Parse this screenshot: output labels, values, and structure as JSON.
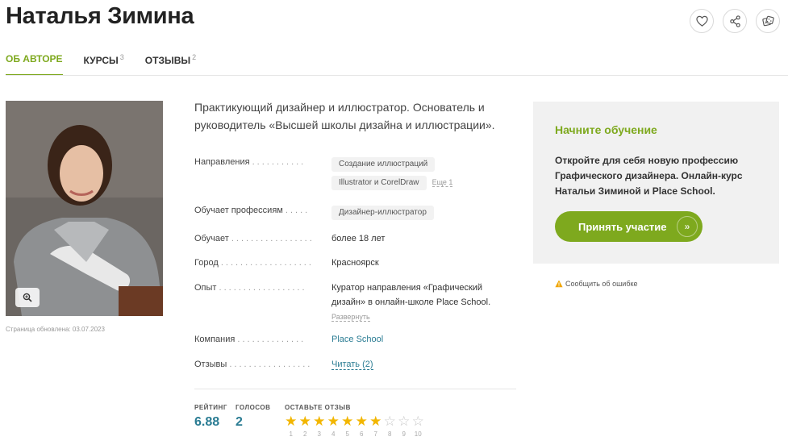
{
  "page": {
    "title": "Наталья Зимина"
  },
  "header_icons": [
    "heart-icon",
    "share-icon",
    "dice-icon"
  ],
  "tabs": [
    {
      "label": "ОБ АВТОРЕ",
      "count": ""
    },
    {
      "label": "КУРСЫ",
      "count": "3"
    },
    {
      "label": "ОТЗЫВЫ",
      "count": "2"
    }
  ],
  "profile": {
    "updated": "Страница обновлена: 03.07.2023",
    "intro": "Практикующий дизайнер и иллюстратор. Основатель и руководитель «Высшей школы дизайна и иллюстрации».",
    "fields": {
      "directions_label": "Направления",
      "directions": [
        "Создание иллюстраций",
        "Illustrator и CorelDraw"
      ],
      "directions_more": "Еще 1",
      "professions_label": "Обучает профессиям",
      "professions": [
        "Дизайнер-иллюстратор"
      ],
      "teaches_label": "Обучает",
      "teaches": "более 18 лет",
      "city_label": "Город",
      "city": "Красноярск",
      "experience_label": "Опыт",
      "experience": "Куратор направления «Графический дизайн» в онлайн-школе Place School.",
      "experience_expand": "Развернуть",
      "company_label": "Компания",
      "company": "Place School",
      "reviews_label": "Отзывы",
      "reviews_link": "Читать (2)"
    }
  },
  "rating": {
    "rating_label": "РЕЙТИНГ",
    "rating_value": "6.88",
    "votes_label": "ГОЛОСОВ",
    "votes_value": "2",
    "leave_label": "ОСТАВЬТЕ ОТЗЫВ",
    "star_value": 7,
    "star_max": 10,
    "star_numbers": [
      "1",
      "2",
      "3",
      "4",
      "5",
      "6",
      "7",
      "8",
      "9",
      "10"
    ],
    "star_color": "#f2b600"
  },
  "cta": {
    "title": "Начните обучение",
    "text": "Откройте для себя новую профессию Графического дизайнера. Онлайн-курс Натальи Зиминой и Place School.",
    "button": "Принять участие",
    "accent": "#7ea91e"
  },
  "report": {
    "label": "Сообщить об ошибке"
  }
}
